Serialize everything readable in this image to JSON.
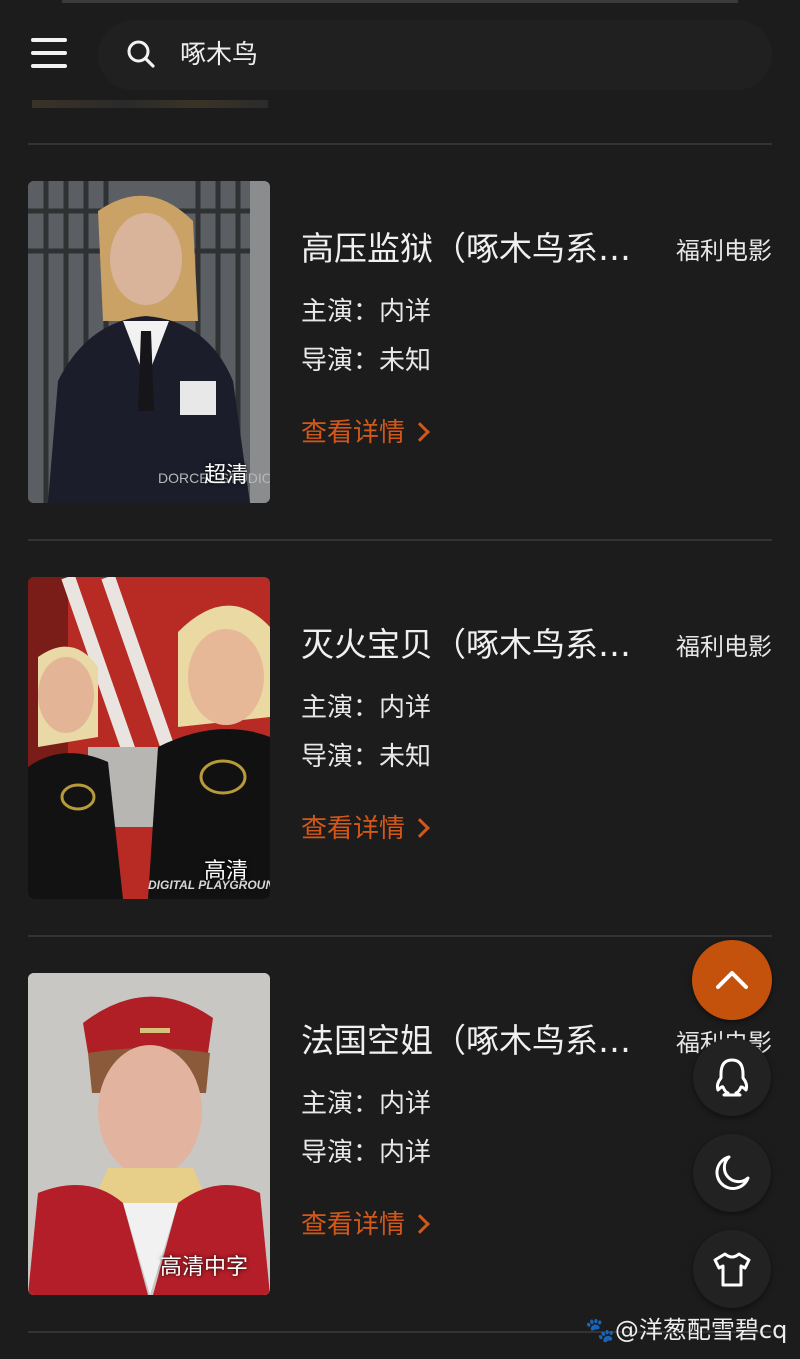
{
  "search": {
    "query": "啄木鸟"
  },
  "items": [
    {
      "title": "高压监狱（啄木鸟系…",
      "category": "福利电影",
      "actor_label": "主演：",
      "actor": "内详",
      "director_label": "导演：",
      "director": "未知",
      "quality": "超清",
      "detail_label": "查看详情",
      "image_text": "DORCEL STUDIO"
    },
    {
      "title": "灭火宝贝（啄木鸟系…",
      "category": "福利电影",
      "actor_label": "主演：",
      "actor": "内详",
      "director_label": "导演：",
      "director": "未知",
      "quality": "高清",
      "detail_label": "查看详情",
      "image_text": "DIGITAL PLAYGROUND"
    },
    {
      "title": "法国空姐（啄木鸟系…",
      "category": "福利电影",
      "actor_label": "主演：",
      "actor": "内详",
      "director_label": "导演：",
      "director": "内详",
      "quality": "高清中字",
      "detail_label": "查看详情",
      "image_text": ""
    }
  ],
  "floating_buttons": {
    "scroll_top": "chevron-up-icon",
    "qq": "qq-penguin-icon",
    "theme": "moon-icon",
    "skin": "shirt-icon"
  },
  "watermark": {
    "text": "@洋葱配雪碧cq"
  },
  "colors": {
    "background": "#1c1c1c",
    "accent": "#d2581a",
    "fab_accent": "#c4520c"
  }
}
